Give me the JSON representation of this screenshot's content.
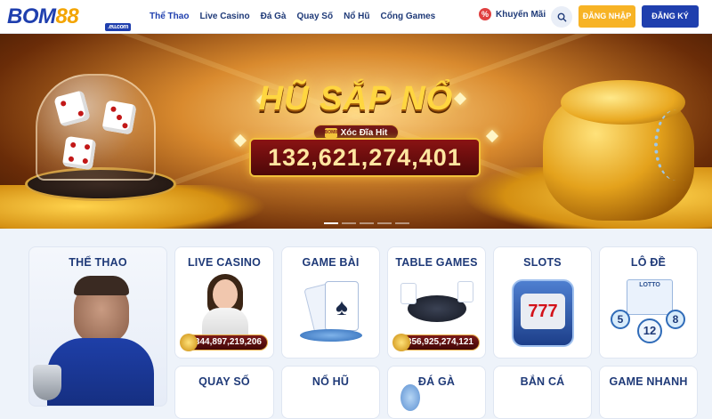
{
  "logo": {
    "text_main": "BOM",
    "text_num": "88",
    "tag": ".eu.com"
  },
  "nav": {
    "items": [
      "Thể Thao",
      "Live Casino",
      "Đá Gà",
      "Quay Số",
      "Nổ Hũ",
      "Cổng Games"
    ]
  },
  "header_actions": {
    "promo_label": "Khuyến Mãi",
    "promo_icon": "%",
    "login_label": "ĐĂNG NHẬP",
    "register_label": "ĐĂNG KÝ"
  },
  "banner": {
    "title": "HŨ SẮP NỔ",
    "game_name": "Xóc Đĩa Hit",
    "game_badge": "BOM88",
    "jackpot_amount": "132,621,274,401",
    "slides_count": 5,
    "active_slide": 1
  },
  "categories": [
    {
      "title": "THỂ THAO"
    },
    {
      "title": "LIVE CASINO",
      "jackpot": "344,897,219,206"
    },
    {
      "title": "GAME BÀI"
    },
    {
      "title": "TABLE GAMES",
      "jackpot": "356,925,274,121"
    },
    {
      "title": "SLOTS"
    },
    {
      "title": "LÔ ĐỀ",
      "lotto_label": "LOTTO",
      "balls": [
        "5",
        "12",
        "8"
      ]
    },
    {
      "title": "QUAY SỐ"
    },
    {
      "title": "NỔ HŨ"
    },
    {
      "title": "ĐÁ GÀ"
    },
    {
      "title": "BẮN CÁ"
    },
    {
      "title": "GAME NHANH"
    }
  ],
  "colors": {
    "brand_blue": "#1f3fae",
    "brand_gold": "#f7b325",
    "jackpot_red": "#7a1a1a"
  }
}
